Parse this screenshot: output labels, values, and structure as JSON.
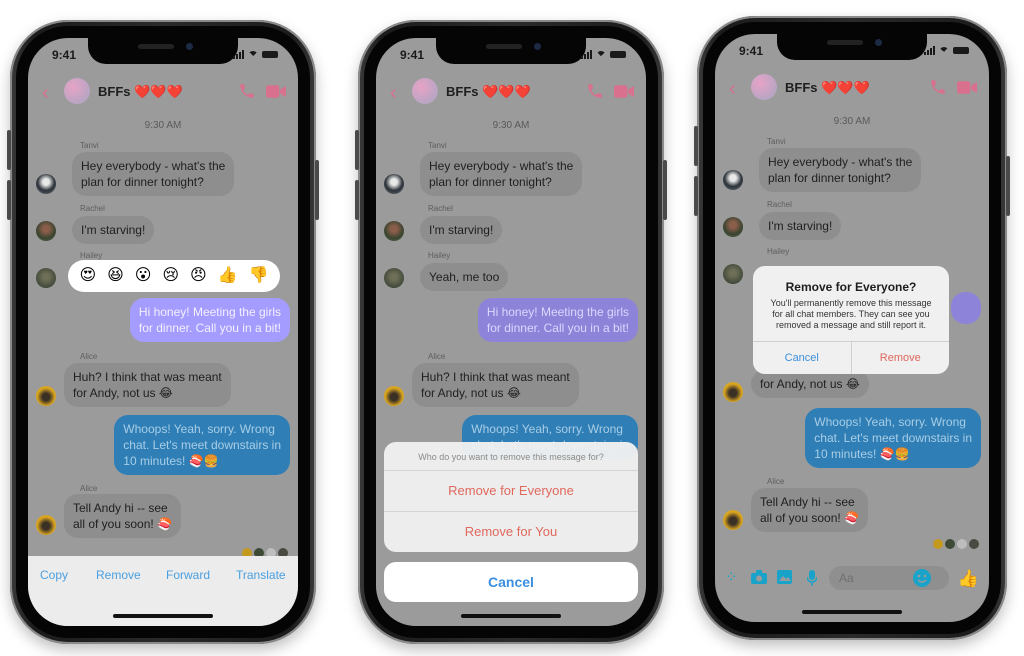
{
  "colors": {
    "accent_pink": "#d9708e",
    "messenger_blue": "#3a8fe0",
    "destructive_red": "#e0685d",
    "purple_bubble": "#a59cff",
    "blue_bubble": "#2f7fb6",
    "composer_teal": "#1aa3c9"
  },
  "screens": [
    {
      "status": {
        "time": "9:41"
      },
      "header": {
        "title": "BFFs ❤️❤️❤️",
        "back_icon": "chevron-left-icon",
        "call_icon": "phone-icon",
        "video_icon": "video-camera-icon"
      },
      "timestamp": "9:30 AM",
      "messages": [
        {
          "sender": "Tanvi",
          "lines": [
            "Hey everybody - what's the",
            "plan for dinner tonight?"
          ]
        },
        {
          "sender": "Rachel",
          "lines": [
            "I'm starving!"
          ]
        },
        {
          "sender": "Hailey",
          "lines": [
            ""
          ]
        },
        {
          "sender": "",
          "lines": [
            "Hi honey! Meeting the girls",
            "for dinner. Call you in a bit!"
          ],
          "outgoing": true
        },
        {
          "sender": "Alice",
          "lines": [
            "Huh? I think that was meant",
            "for Andy, not us 😂"
          ]
        },
        {
          "sender": "",
          "lines": [
            "Whoops! Yeah, sorry. Wrong",
            "chat. Let's meet downstairs in",
            "10 minutes! 🍣🍔"
          ],
          "outgoing": true
        },
        {
          "sender": "Alice",
          "lines": [
            "Tell Andy hi -- see",
            "all of you soon! 🍣"
          ]
        }
      ],
      "reactions": [
        "😍",
        "😆",
        "😮",
        "😢",
        "😠",
        "👍",
        "👎"
      ],
      "actions": [
        "Copy",
        "Remove",
        "Forward",
        "Translate"
      ]
    },
    {
      "status": {
        "time": "9:41"
      },
      "header": {
        "title": "BFFs ❤️❤️❤️"
      },
      "timestamp": "9:30 AM",
      "messages": [
        {
          "sender": "Tanvi",
          "lines": [
            "Hey everybody - what's the",
            "plan for dinner tonight?"
          ]
        },
        {
          "sender": "Rachel",
          "lines": [
            "I'm starving!"
          ]
        },
        {
          "sender": "Hailey",
          "lines": [
            "Yeah, me too"
          ]
        },
        {
          "sender": "",
          "lines": [
            "Hi honey! Meeting the girls",
            "for dinner. Call you in a bit!"
          ],
          "outgoing": true
        },
        {
          "sender": "Alice",
          "lines": [
            "Huh? I think that was meant",
            "for Andy, not us 😂"
          ]
        },
        {
          "sender": "",
          "lines": [
            "Whoops! Yeah, sorry. Wrong",
            "chat. Let's meet downstairs in"
          ],
          "outgoing": true
        }
      ],
      "action_sheet": {
        "prompt": "Who do you want to remove this message for?",
        "options": [
          "Remove for Everyone",
          "Remove for You"
        ],
        "cancel": "Cancel"
      }
    },
    {
      "status": {
        "time": "9:41"
      },
      "header": {
        "title": "BFFs ❤️❤️❤️"
      },
      "timestamp": "9:30 AM",
      "messages": [
        {
          "sender": "Tanvi",
          "lines": [
            "Hey everybody - what's the",
            "plan for dinner tonight?"
          ]
        },
        {
          "sender": "Rachel",
          "lines": [
            "I'm starving!"
          ]
        },
        {
          "sender": "Hailey",
          "lines": [
            ""
          ]
        },
        {
          "sender": "Alice",
          "lines": [
            "for Andy, not us 😂"
          ]
        },
        {
          "sender": "",
          "lines": [
            "Whoops! Yeah, sorry. Wrong",
            "chat. Let's meet downstairs in",
            "10 minutes! 🍣🍔"
          ],
          "outgoing": true
        },
        {
          "sender": "Alice",
          "lines": [
            "Tell Andy hi -- see",
            "all of you soon! 🍣"
          ]
        }
      ],
      "alert": {
        "title": "Remove for Everyone?",
        "message": "You'll permanently remove this message for all chat members. They can see you removed a message and still report it.",
        "cancel": "Cancel",
        "confirm": "Remove"
      },
      "composer": {
        "placeholder": "Aa",
        "icons": [
          "apps-icon",
          "camera-icon",
          "gallery-icon",
          "microphone-icon",
          "emoji-icon",
          "thumbs-up-icon"
        ]
      }
    }
  ]
}
